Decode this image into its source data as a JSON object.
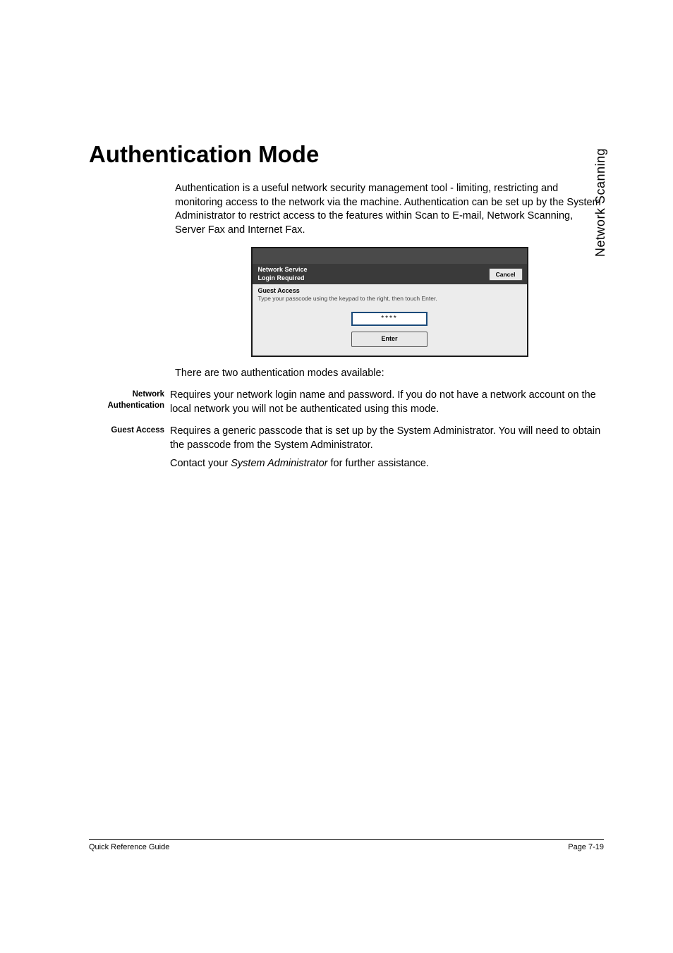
{
  "side_label": "Network Scanning",
  "heading": "Authentication Mode",
  "intro": "Authentication is a useful network security management tool - limiting, restricting and monitoring access to the network via the machine. Authentication can be set up by the System Administrator to restrict access to the features within Scan to E-mail, Network Scanning, Server Fax and Internet Fax.",
  "screenshot": {
    "title_line1": "Network Service",
    "title_line2": "Login Required",
    "cancel": "Cancel",
    "guest": "Guest Access",
    "desc": "Type your passcode using the keypad to the right, then touch Enter.",
    "masked": "****",
    "enter": "Enter"
  },
  "after_screenshot": "There are two authentication modes available:",
  "defs": {
    "network_auth": {
      "term_l1": "Network",
      "term_l2": "Authentication",
      "body": "Requires your network login name and password. If you do not have a network account on the local network you will not be authenticated using this mode."
    },
    "guest_access": {
      "term": "Guest Access",
      "body1": "Requires a generic passcode that is set up by the System Administrator. You will need to obtain the passcode from the System Administrator.",
      "body2a": "Contact your ",
      "body2b": "System Administrator",
      "body2c": " for further assistance."
    }
  },
  "footer": {
    "left": "Quick Reference Guide",
    "right": "Page 7-19"
  }
}
